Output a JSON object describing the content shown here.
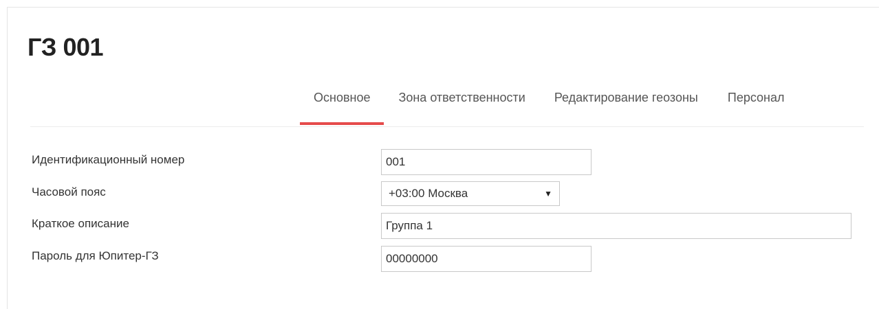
{
  "header": {
    "title": "ГЗ 001"
  },
  "tabs": [
    {
      "label": "Основное",
      "active": true
    },
    {
      "label": "Зона ответственности",
      "active": false
    },
    {
      "label": "Редактирование геозоны",
      "active": false
    },
    {
      "label": "Персонал",
      "active": false
    }
  ],
  "form": {
    "id_label": "Идентификационный номер",
    "id_value": "001",
    "timezone_label": "Часовой пояс",
    "timezone_value": "+03:00 Москва",
    "description_label": "Краткое описание",
    "description_value": "Группа 1",
    "password_label": "Пароль для Юпитер-ГЗ",
    "password_value": "00000000"
  },
  "icons": {
    "select_arrow": "▼"
  },
  "colors": {
    "active_tab_underline": "#e54b4b"
  }
}
